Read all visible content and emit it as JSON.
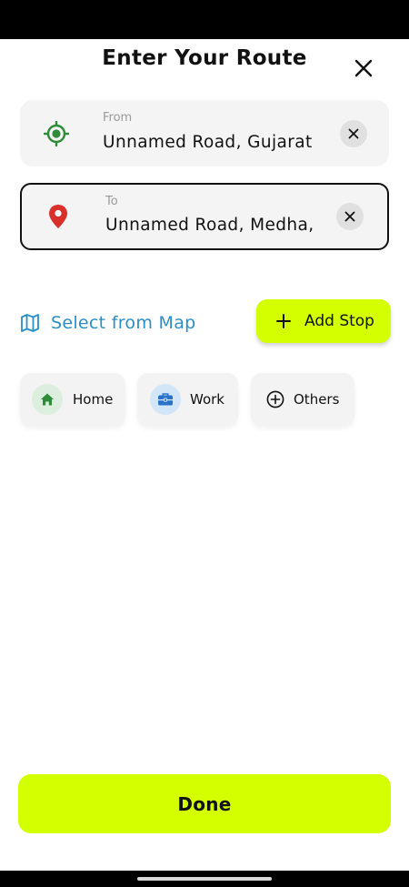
{
  "header": {
    "title": "Enter Your Route"
  },
  "from_field": {
    "label": "From",
    "value": "Unnamed Road, Gujarat"
  },
  "to_field": {
    "label": "To",
    "value": "Unnamed Road, Medha,"
  },
  "actions": {
    "select_map_label": "Select from Map",
    "add_stop_label": "Add Stop"
  },
  "chips": [
    {
      "label": "Home",
      "icon": "home-icon"
    },
    {
      "label": "Work",
      "icon": "briefcase-icon"
    },
    {
      "label": "Others",
      "icon": "plus-circle-icon"
    }
  ],
  "footer": {
    "done_label": "Done"
  },
  "colors": {
    "accent": "#d4ff00",
    "link": "#2a8fc7",
    "origin_green": "#2e8b3a",
    "destination_red": "#d9302c",
    "work_blue": "#2a73c9"
  }
}
